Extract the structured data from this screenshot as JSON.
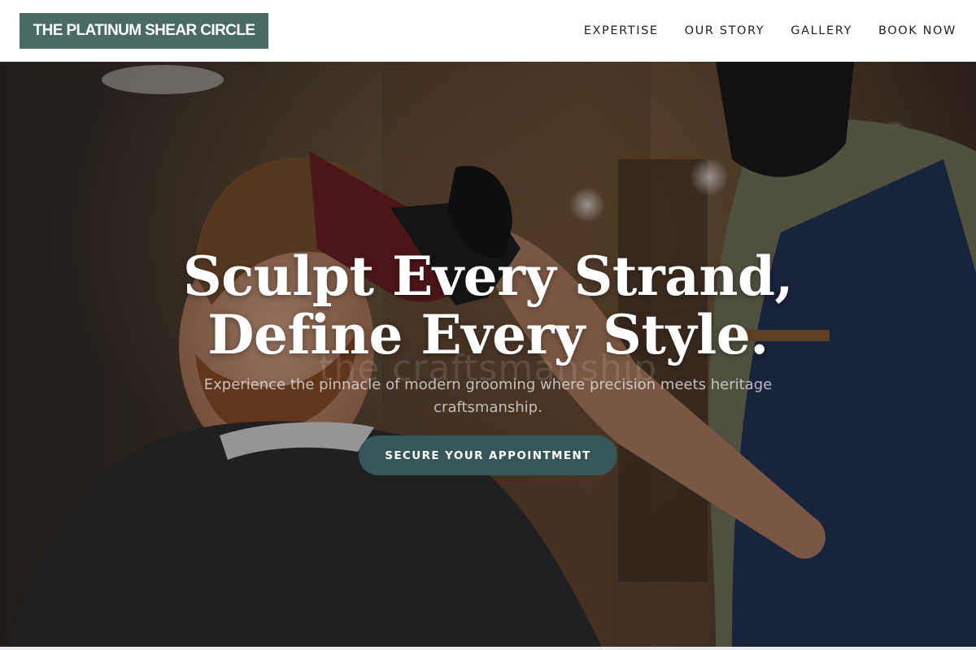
{
  "header": {
    "logo": "THE PLATINUM SHEAR CIRCLE",
    "nav": [
      {
        "label": "EXPERTISE"
      },
      {
        "label": "OUR STORY"
      },
      {
        "label": "GALLERY"
      },
      {
        "label": "BOOK NOW"
      }
    ]
  },
  "hero": {
    "headline_line1": "Sculpt Every Strand,",
    "headline_line2": "Define Every Style.",
    "background_watermark": "the craftsmanship",
    "subtitle": "Experience the pinnacle of modern grooming where precision meets heritage craftsmanship.",
    "cta_label": "SECURE YOUR APPOINTMENT",
    "image_description_icon": "barbershop-photo"
  },
  "colors": {
    "brand": "#4a6b64",
    "cta": "#35575a",
    "text_dark": "#222222"
  }
}
